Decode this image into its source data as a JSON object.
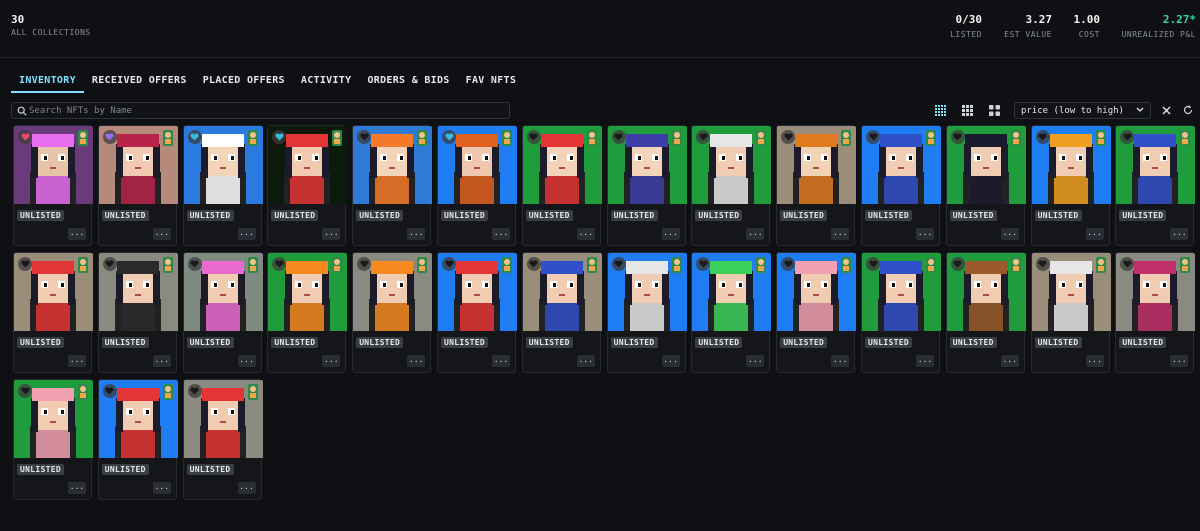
{
  "header": {
    "collections_count": "30",
    "collections_label": "ALL COLLECTIONS",
    "stats": [
      {
        "value": "0/30",
        "label": "LISTED"
      },
      {
        "value": "3.27",
        "label": "EST VALUE"
      },
      {
        "value": "1.00",
        "label": "COST"
      },
      {
        "value": "2.27*",
        "label": "UNREALIZED P&L"
      }
    ]
  },
  "tabs": [
    "INVENTORY",
    "RECEIVED OFFERS",
    "PLACED OFFERS",
    "ACTIVITY",
    "ORDERS & BIDS",
    "FAV NFTS"
  ],
  "search": {
    "placeholder": "Search NFTs by Name"
  },
  "sort": {
    "value": "price (low to high)"
  },
  "colors": {
    "accent": "#7fe0ff",
    "positive": "#38d39f"
  },
  "card_badge": "UNLISTED",
  "card_more": "...",
  "cards": [
    {
      "bg": "#6b3a7a",
      "face": "#e7c3a8",
      "hat": "#e86cf0",
      "heart": "#e84b6a"
    },
    {
      "bg": "#b58a7a",
      "face": "#f1c8b0",
      "hat": "#b8234a",
      "heart": "#9b6bf0"
    },
    {
      "bg": "#2a7ae0",
      "face": "#f2d4b8",
      "hat": "#ffffff",
      "heart": "#3ab8d8"
    },
    {
      "bg": "#0c1a0c",
      "face": "#f0c9b0",
      "hat": "#e33535",
      "heart": "#3ab8d8"
    },
    {
      "bg": "#2f7ad6",
      "face": "#f2d4b8",
      "hat": "#f47a2a",
      "heart": ""
    },
    {
      "bg": "#1e7df2",
      "face": "#f0c7ae",
      "hat": "#e0601f",
      "heart": "#3ab8d8"
    },
    {
      "bg": "#1f9c3c",
      "face": "#f3d3b9",
      "hat": "#e33535",
      "heart": ""
    },
    {
      "bg": "#1f9c3c",
      "face": "#f3d3b9",
      "hat": "#3e3ea8",
      "heart": ""
    },
    {
      "bg": "#1f9c3c",
      "face": "#f0ccb3",
      "hat": "#e6e6e6",
      "heart": ""
    },
    {
      "bg": "#9a8d7a",
      "face": "#f0d2b5",
      "hat": "#e07a20",
      "heart": ""
    },
    {
      "bg": "#1e7df2",
      "face": "#f0ccb3",
      "hat": "#2f50c8",
      "heart": ""
    },
    {
      "bg": "#1f9c3c",
      "face": "#f0ccb3",
      "hat": "#1a1a2e",
      "heart": ""
    },
    {
      "bg": "#1e7df2",
      "face": "#f0ccb3",
      "hat": "#f0a020",
      "heart": ""
    },
    {
      "bg": "#1f9c3c",
      "face": "#f0ccb3",
      "hat": "#2f50c8",
      "heart": ""
    },
    {
      "bg": "#9a8d7a",
      "face": "#f0ccb3",
      "hat": "#e33535",
      "heart": ""
    },
    {
      "bg": "#8a8a80",
      "face": "#f0ccb3",
      "hat": "#2a2a2a",
      "heart": ""
    },
    {
      "bg": "#7f8b80",
      "face": "#f0ccb3",
      "hat": "#e86cd0",
      "heart": ""
    },
    {
      "bg": "#1f9c3c",
      "face": "#f0ccb3",
      "hat": "#f48a20",
      "heart": ""
    },
    {
      "bg": "#8a8a80",
      "face": "#f0ccb3",
      "hat": "#f48a20",
      "heart": ""
    },
    {
      "bg": "#1e7df2",
      "face": "#f0ccb3",
      "hat": "#e33535",
      "heart": ""
    },
    {
      "bg": "#9a8d7a",
      "face": "#f0ccb3",
      "hat": "#2f50c8",
      "heart": ""
    },
    {
      "bg": "#1e7df2",
      "face": "#f0ccb3",
      "hat": "#e6e6e6",
      "heart": ""
    },
    {
      "bg": "#1e7df2",
      "face": "#f0ccb3",
      "hat": "#3bd05a",
      "heart": ""
    },
    {
      "bg": "#1e7df2",
      "face": "#f0ccb3",
      "hat": "#f0a0b0",
      "heart": ""
    },
    {
      "bg": "#1f9c3c",
      "face": "#f0ccb3",
      "hat": "#2f50c8",
      "heart": ""
    },
    {
      "bg": "#1f9c3c",
      "face": "#f0ccb3",
      "hat": "#9a5a2a",
      "heart": ""
    },
    {
      "bg": "#9a8d7a",
      "face": "#f0ccb3",
      "hat": "#e6e6e6",
      "heart": ""
    },
    {
      "bg": "#8a8a80",
      "face": "#f0ccb3",
      "hat": "#c0306a",
      "heart": ""
    },
    {
      "bg": "#1f9c3c",
      "face": "#f0ccb3",
      "hat": "#f0a0b0",
      "heart": ""
    },
    {
      "bg": "#1e7df2",
      "face": "#f0ccb3",
      "hat": "#e33535",
      "heart": ""
    },
    {
      "bg": "#8a8a80",
      "face": "#f0ccb3",
      "hat": "#e33535",
      "heart": ""
    }
  ]
}
